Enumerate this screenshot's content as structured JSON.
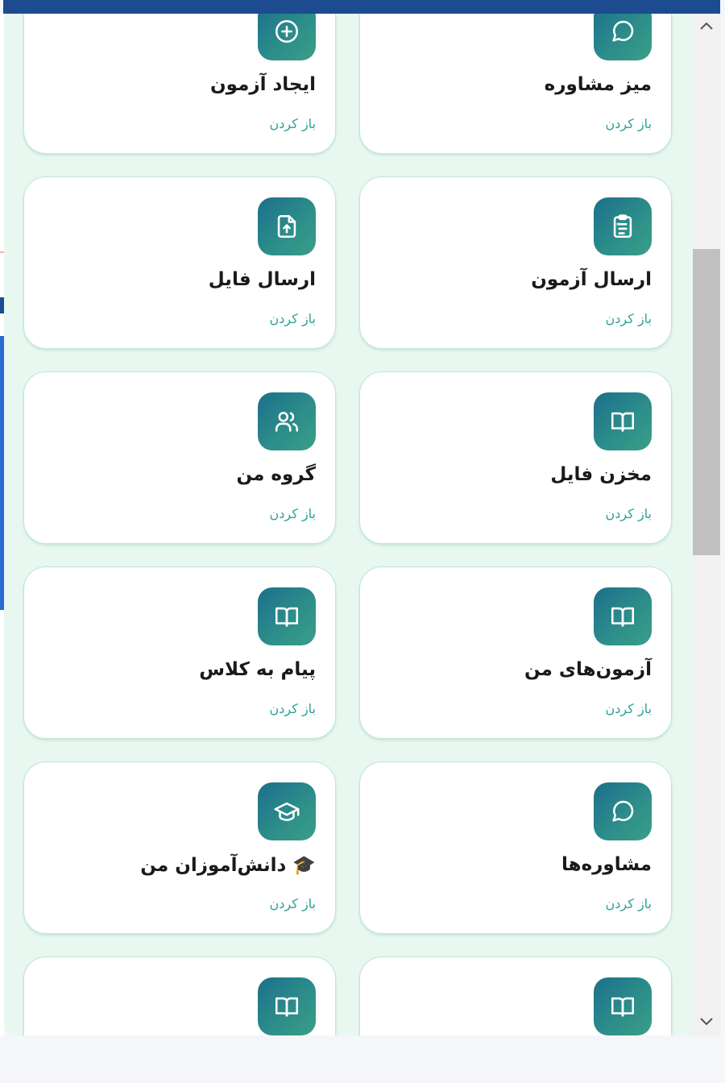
{
  "colors": {
    "topbar": "#1d4b8f",
    "panel_background": "#e8f8f1",
    "card_border": "#bfe6d5",
    "icon_gradient_start": "#1c6f8c",
    "icon_gradient_end": "#3a9f86",
    "open_link": "#2aa39a",
    "title_text": "#1a1a1a"
  },
  "grid": {
    "cards": [
      {
        "title": "میز مشاوره",
        "open_label": "باز کردن",
        "icon": "chat-bubble-icon"
      },
      {
        "title": "ایجاد آزمون",
        "open_label": "باز کردن",
        "icon": "plus-circle-icon"
      },
      {
        "title": "ارسال آزمون",
        "open_label": "باز کردن",
        "icon": "clipboard-list-icon"
      },
      {
        "title": "ارسال فایل",
        "open_label": "باز کردن",
        "icon": "file-upload-icon"
      },
      {
        "title": "مخزن فایل",
        "open_label": "باز کردن",
        "icon": "open-book-icon"
      },
      {
        "title": "گروه من",
        "open_label": "باز کردن",
        "icon": "users-icon"
      },
      {
        "title": "آزمون‌های من",
        "open_label": "باز کردن",
        "icon": "open-book-icon"
      },
      {
        "title": "پیام به کلاس",
        "open_label": "باز کردن",
        "icon": "open-book-icon"
      },
      {
        "title": "مشاوره‌ها",
        "open_label": "باز کردن",
        "icon": "chat-bubble-icon"
      },
      {
        "title": "🎓 دانش‌آموزان من",
        "open_label": "باز کردن",
        "icon": "graduation-cap-icon"
      },
      {
        "title": "",
        "open_label": "",
        "icon": "open-book-icon"
      },
      {
        "title": "",
        "open_label": "",
        "icon": "open-book-icon"
      }
    ]
  },
  "scrollbar": {
    "up_icon": "chevron-up-icon",
    "down_icon": "chevron-down-icon"
  }
}
